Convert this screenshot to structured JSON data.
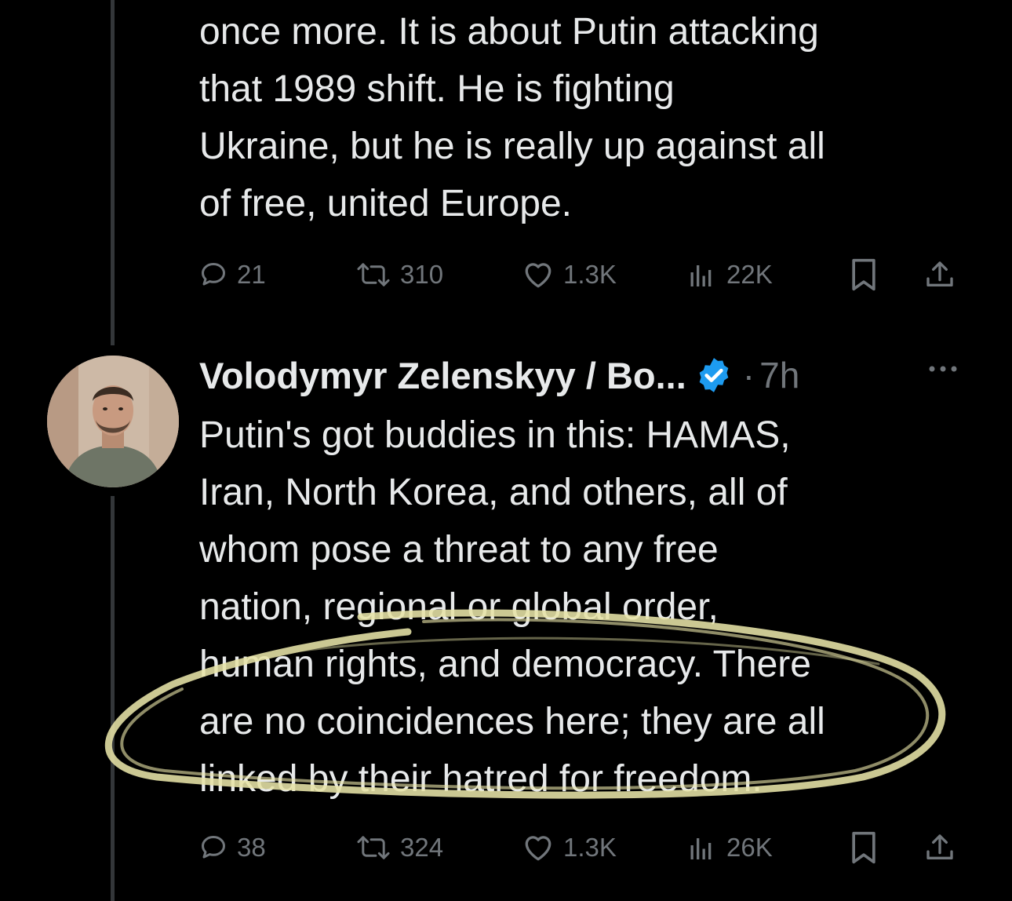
{
  "tweet1": {
    "text": "once more. It is about Putin attacking\nthat 1989 shift. He is fighting\nUkraine, but he is really up against all\nof free, united Europe.",
    "replies": "21",
    "retweets": "310",
    "likes": "1.3K",
    "views": "22K"
  },
  "tweet2": {
    "author_name": "Volodymyr Zelenskyy / Bo...",
    "separator": "·",
    "time": "7h",
    "text": "Putin's got buddies in this: HAMAS,\nIran, North Korea, and others, all of\nwhom pose a threat to any free\nnation, regional or global order,\nhuman rights, and democracy. There\nare no coincidences here; they are all\nlinked by their hatred for freedom.",
    "replies": "38",
    "retweets": "324",
    "likes": "1.3K",
    "views": "26K"
  },
  "colors": {
    "background": "#000000",
    "text": "#e7e9ea",
    "muted": "#71767b",
    "verified_badge": "#1d9bf0",
    "highlight_scribble": "#e8e4a8",
    "thread_line": "#333639"
  },
  "icons": [
    "reply-icon",
    "retweet-icon",
    "like-icon",
    "views-icon",
    "bookmark-icon",
    "share-icon",
    "verified-badge-icon",
    "more-icon"
  ]
}
